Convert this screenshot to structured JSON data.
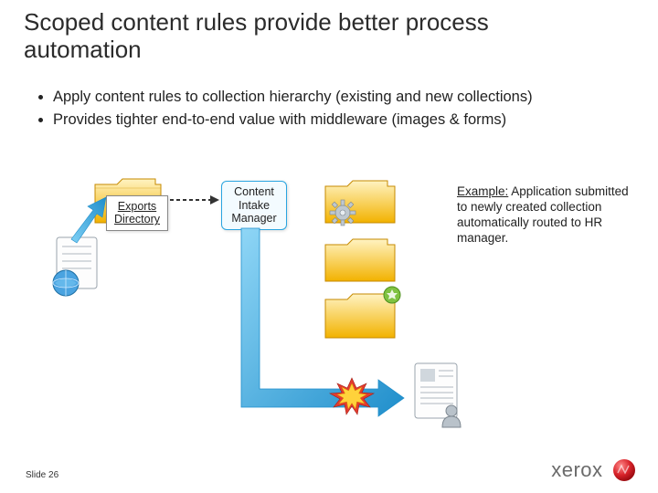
{
  "title": "Scoped content rules provide better process automation",
  "bullets": [
    "Apply content rules to collection hierarchy (existing and new collections)",
    "Provides tighter end-to-end value with middleware (images & forms)"
  ],
  "labels": {
    "exports": "Exports Directory",
    "intake": "Content Intake Manager"
  },
  "example": {
    "prefix": "Example:",
    "body": " Application submitted to newly created collection automatically routed to HR manager."
  },
  "footer": {
    "slide_label": "Slide 26"
  },
  "brand": {
    "name": "xerox"
  },
  "colors": {
    "folder_light": "#ffe18a",
    "folder_dark": "#f2b200",
    "folder_edge": "#c68a00",
    "arrow": "#33a6df",
    "arc_border": "#2aa5e0",
    "logo_ball": "#d8232a"
  },
  "icons": {
    "exports_folder": "folder-icon",
    "intake_box": "content-intake-box",
    "web_document": "document-globe-icon",
    "gear": "gear-icon",
    "new_badge": "new-starburst-icon",
    "hr_document": "document-person-icon"
  }
}
